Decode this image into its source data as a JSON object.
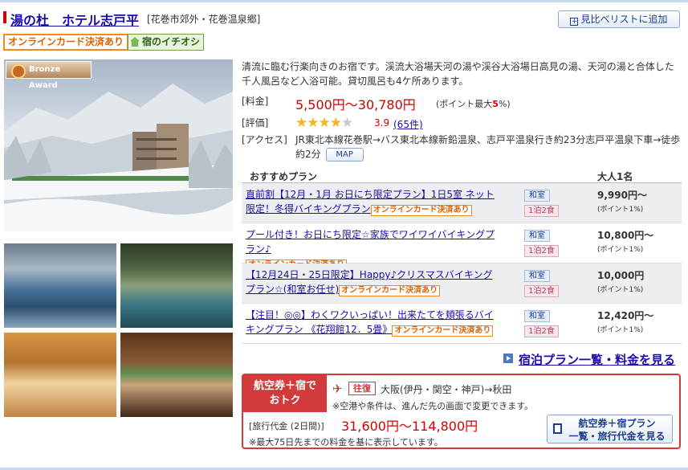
{
  "header": {
    "hotel_name": "湯の杜　ホテル志戸平",
    "area": "[花巻市郊外・花巻温泉郷]",
    "compare_button": "見比べリストに追加"
  },
  "badges": {
    "online_card": "オンラインカード決済あり",
    "pick": "宿のイチオシ"
  },
  "award": "Bronze Award",
  "description": "清流に臨む行楽向きのお宿です。渓流大浴場天河の湯や渓谷大浴場日高見の湯、天河の湯と合体した千人風呂など入浴可能。貸切風呂も4ケ所あります。",
  "info": {
    "price_label": "[料金]",
    "price": "5,500円～30,780円",
    "point_max_prefix": "(ポイント最大",
    "point_max_value": "5",
    "point_max_suffix": "%)",
    "rating_label": "[評価]",
    "rating": "3.9",
    "rating_stars": 3.9,
    "review_count": "(65件)",
    "access_label": "[アクセス]",
    "access": "JR東北本線花巻駅→バス東北本線新鉛温泉、志戸平温泉行き約23分志戸平温泉下車→徒歩約2分",
    "map_button": "MAP"
  },
  "plans": {
    "header_plan": "おすすめプラン",
    "header_price": "大人1名",
    "rows": [
      {
        "name": "直前割【12月・1月 お日にち限定プラン】1日5室 ネット限定！冬得バイキングプラン",
        "badge": "オンラインカード決済あり",
        "room": "和室",
        "meal": "1泊2食",
        "price": "9,990円～",
        "point": "(ポイント1%)"
      },
      {
        "name": "プール付き！お日にち限定☆家族でワイワイバイキングプラン♪",
        "badge": "オンラインカード決済あり",
        "room": "和室",
        "meal": "1泊2食",
        "price": "10,800円～",
        "point": "(ポイント1%)"
      },
      {
        "name": "【12月24日・25日限定】Happy♪クリスマスバイキングプラン☆(和室お任せ)",
        "badge": "オンラインカード決済あり",
        "room": "和室",
        "meal": "1泊2食",
        "price": "10,000円",
        "point": "(ポイント1%)"
      },
      {
        "name": "【注目！◎◎】わくワクいっぱい！出来たてを頬張るバイキングプラン 《花翔館12．5畳》",
        "badge": "オンラインカード決済あり",
        "room": "和室",
        "meal": "1泊2食",
        "price": "12,420円～",
        "point": "(ポイント1%)"
      }
    ],
    "all_plans_link": "宿泊プラン一覧・料金を見る"
  },
  "air": {
    "label_line1": "航空券＋宿で",
    "label_line2": "おトク",
    "round_trip": "往復",
    "route": "大阪(伊丹・関空・神戸)→秋田",
    "note1": "※空港や条件は、進んだ先の画面で変更できます。",
    "price_label": "[旅行代金 (2日間)]",
    "price": "31,600円～114,800円",
    "note2": "※最大75日先までの料金を基に表示しています。",
    "button_line1": "航空券＋宿プラン",
    "button_line2": "一覧・旅行代金を見る"
  },
  "colors": {
    "accent_red": "#d40000",
    "link_blue": "#1a0dab",
    "online_orange": "#f08a1c"
  }
}
